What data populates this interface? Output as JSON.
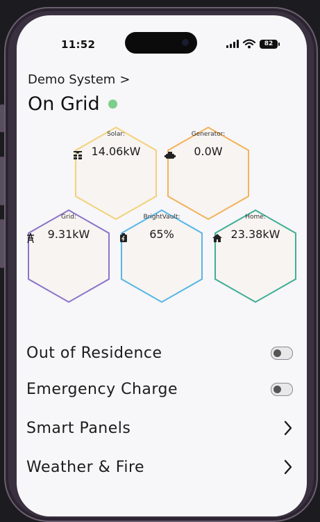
{
  "status_bar": {
    "time": "11:52",
    "battery": "82"
  },
  "header": {
    "system_name": "Demo System",
    "breadcrumb_chevron": ">",
    "status_title": "On Grid",
    "status_color": "#7ccf8b"
  },
  "nodes": {
    "solar": {
      "label": "Solar:",
      "value": "14.06kW",
      "color": "#f2d27a",
      "icon": "solar-panel-icon"
    },
    "generator": {
      "label": "Generator:",
      "value": "0.0W",
      "color": "#f3b25a",
      "icon": "generator-icon"
    },
    "grid": {
      "label": "Grid:",
      "value": "9.31kW",
      "color": "#8b74c9",
      "icon": "power-tower-icon"
    },
    "brightvault": {
      "label": "BrightVault:",
      "value": "65%",
      "color": "#57b6e6",
      "icon": "battery-vault-icon"
    },
    "home": {
      "label": "Home:",
      "value": "23.38kW",
      "color": "#3fae95",
      "icon": "home-icon"
    }
  },
  "settings": {
    "out_of_residence": {
      "label": "Out of Residence",
      "enabled": false
    },
    "emergency_charge": {
      "label": "Emergency Charge",
      "enabled": false
    },
    "smart_panels": {
      "label": "Smart Panels"
    },
    "weather_fire": {
      "label": "Weather & Fire"
    }
  }
}
